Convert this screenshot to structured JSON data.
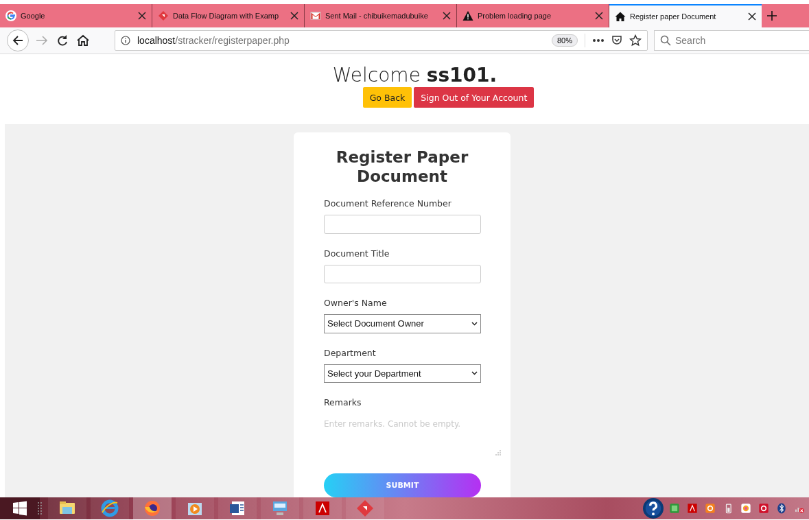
{
  "browser": {
    "tabs": [
      {
        "label": "Google",
        "selected": false
      },
      {
        "label": "Data Flow Diagram with Examp",
        "selected": false
      },
      {
        "label": "Sent Mail - chibuikemadubuike",
        "selected": false
      },
      {
        "label": "Problem loading page",
        "selected": false
      },
      {
        "label": "Register paper Document",
        "selected": true
      }
    ],
    "url": {
      "host": "localhost",
      "path": "/stracker/registerpaper.php"
    },
    "zoom": "80%",
    "search": {
      "placeholder": "Search"
    }
  },
  "header": {
    "welcome": "Welcome **ss101.**",
    "buttons": [
      {
        "label": "Go Back",
        "kind": "warning"
      },
      {
        "label": "Sign Out of Your Account",
        "kind": "danger"
      }
    ]
  },
  "form": {
    "title": "Register Paper Document",
    "fields": [
      {
        "label": "Document Reference Number",
        "kind": "text"
      },
      {
        "label": "Document Title",
        "kind": "text"
      },
      {
        "label": "Owner's Name",
        "kind": "select",
        "value": "Select Document Owner"
      },
      {
        "label": "Department",
        "kind": "select",
        "value": "Select your Department"
      },
      {
        "label": "Remarks",
        "kind": "textarea",
        "placeholder": "Enter remarks. Cannot be empty."
      }
    ],
    "submit": "SUBMIT"
  }
}
